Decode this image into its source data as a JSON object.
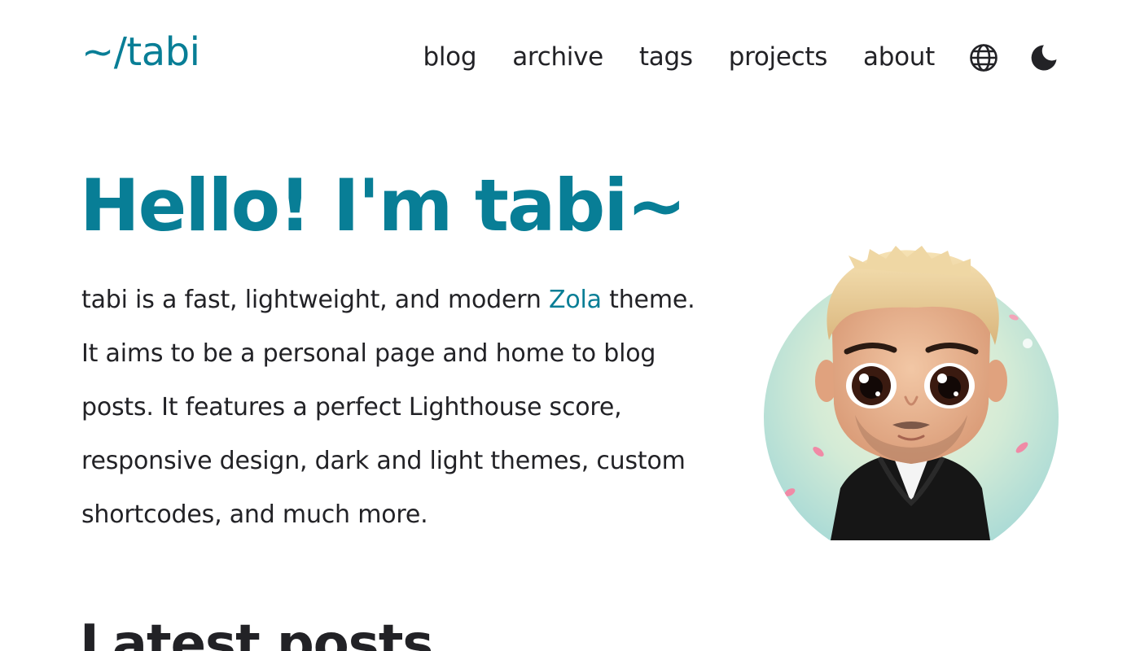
{
  "header": {
    "site_title": "~/tabi",
    "nav": [
      {
        "label": "blog"
      },
      {
        "label": "archive"
      },
      {
        "label": "tags"
      },
      {
        "label": "projects"
      },
      {
        "label": "about"
      }
    ],
    "icons": {
      "language": "globe-icon",
      "theme": "moon-icon"
    }
  },
  "hero": {
    "title": "Hello! I'm tabi~",
    "text_before_link": "tabi is a fast, lightweight, and modern ",
    "link_label": "Zola",
    "text_after_link": " theme. It aims to be a personal page and home to blog posts. It features a perfect Lighthouse score, responsive design, dark and light themes, custom shortcodes, and much more."
  },
  "latest_posts": {
    "heading": "Latest posts"
  },
  "colors": {
    "accent": "#087e96",
    "text": "#222226",
    "background": "#ffffff"
  }
}
